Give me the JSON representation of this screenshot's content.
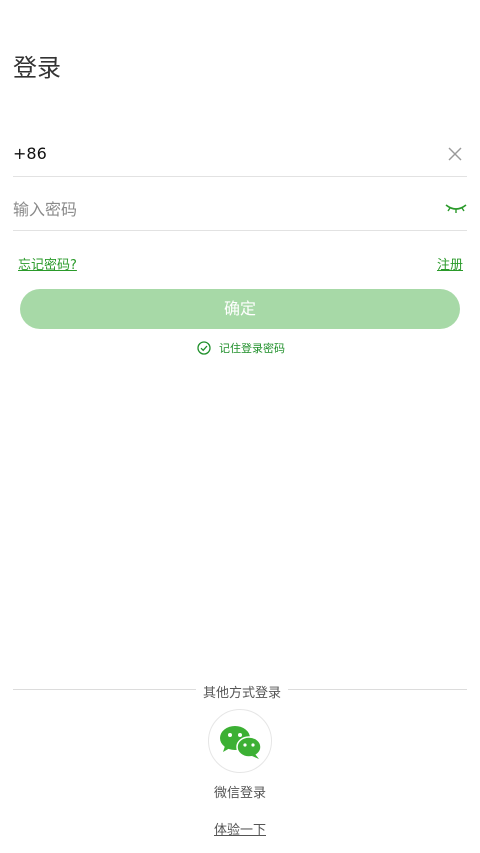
{
  "header": {
    "title": "登录"
  },
  "phone": {
    "country_code": "+86"
  },
  "password": {
    "placeholder": "输入密码",
    "value": ""
  },
  "links": {
    "forgot": "忘记密码?",
    "register": "注册"
  },
  "confirm_button": {
    "label": "确定"
  },
  "remember": {
    "label": "记住登录密码",
    "checked": true
  },
  "other_login": {
    "divider_label": "其他方式登录",
    "wechat_label": "微信登录",
    "trial_label": "体验一下"
  },
  "colors": {
    "accent": "#2a9a2a",
    "button_disabled": "#a7d9a7",
    "wechat": "#3cb034"
  },
  "icons": {
    "clear": "close-icon",
    "eye": "eye-closed-icon",
    "remember": "check-circle-icon",
    "wechat": "wechat-icon"
  }
}
